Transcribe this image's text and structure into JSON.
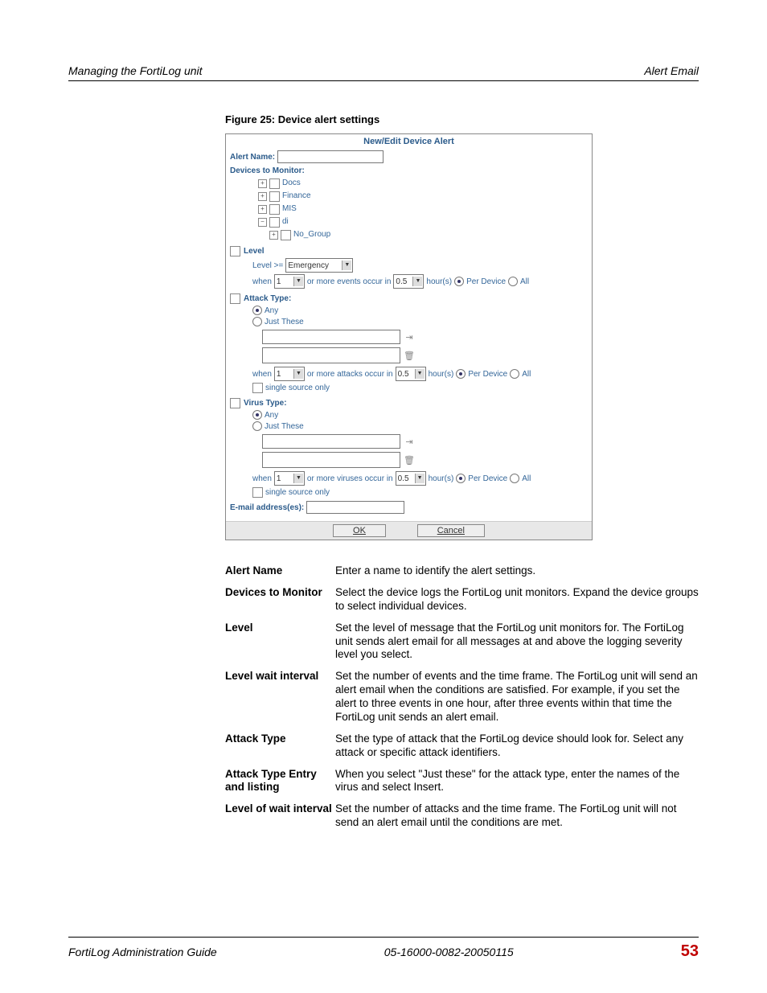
{
  "header": {
    "left": "Managing the FortiLog unit",
    "right": "Alert Email"
  },
  "figure_caption": "Figure 25: Device alert settings",
  "panel": {
    "title": "New/Edit Device Alert",
    "alert_name_label": "Alert Name:",
    "devices_label": "Devices to Monitor:",
    "tree": [
      "Docs",
      "Finance",
      "MIS",
      "di",
      "No_Group"
    ],
    "level_label": "Level",
    "level_prefix": "Level >=",
    "level_value": "Emergency",
    "when": "when",
    "count_default": "1",
    "events_text": "or more events occur in",
    "attacks_text": "or more attacks occur in",
    "viruses_text": "or more viruses occur in",
    "interval_default": "0.5",
    "hours_label": "hour(s)",
    "per_device": "Per Device",
    "all": "All",
    "attack_type_label": "Attack Type:",
    "virus_type_label": "Virus Type:",
    "any": "Any",
    "just_these": "Just These",
    "single_source": "single source only",
    "email_label": "E-mail address(es):",
    "ok": "OK",
    "cancel": "Cancel"
  },
  "descriptions": [
    {
      "term": "Alert Name",
      "def": "Enter a name to identify the alert settings."
    },
    {
      "term": "Devices to Monitor",
      "def": "Select the device logs the FortiLog unit monitors. Expand the device groups to select individual devices."
    },
    {
      "term": "Level",
      "def": "Set the level of message that the FortiLog unit monitors for. The FortiLog unit sends alert email for all messages at and above the logging severity level you select."
    },
    {
      "term": "Level wait interval",
      "def": "Set the number of events and the time frame. The FortiLog unit will send an alert email when the conditions are satisfied. For example, if you set the alert to three events in one hour, after three events within that time the FortiLog unit sends an alert email."
    },
    {
      "term": "Attack Type",
      "def": "Set the type of attack that the FortiLog device should look for. Select any attack or specific attack identifiers."
    },
    {
      "term": "Attack Type Entry and listing",
      "def": "When you select \"Just these\" for the attack type, enter the names of the virus and select Insert."
    },
    {
      "term": "Level of wait interval",
      "def": "Set the number of attacks and the time frame. The FortiLog unit will not send an alert email until the conditions are met."
    }
  ],
  "footer": {
    "left": "FortiLog Administration Guide",
    "center": "05-16000-0082-20050115",
    "page": "53"
  }
}
